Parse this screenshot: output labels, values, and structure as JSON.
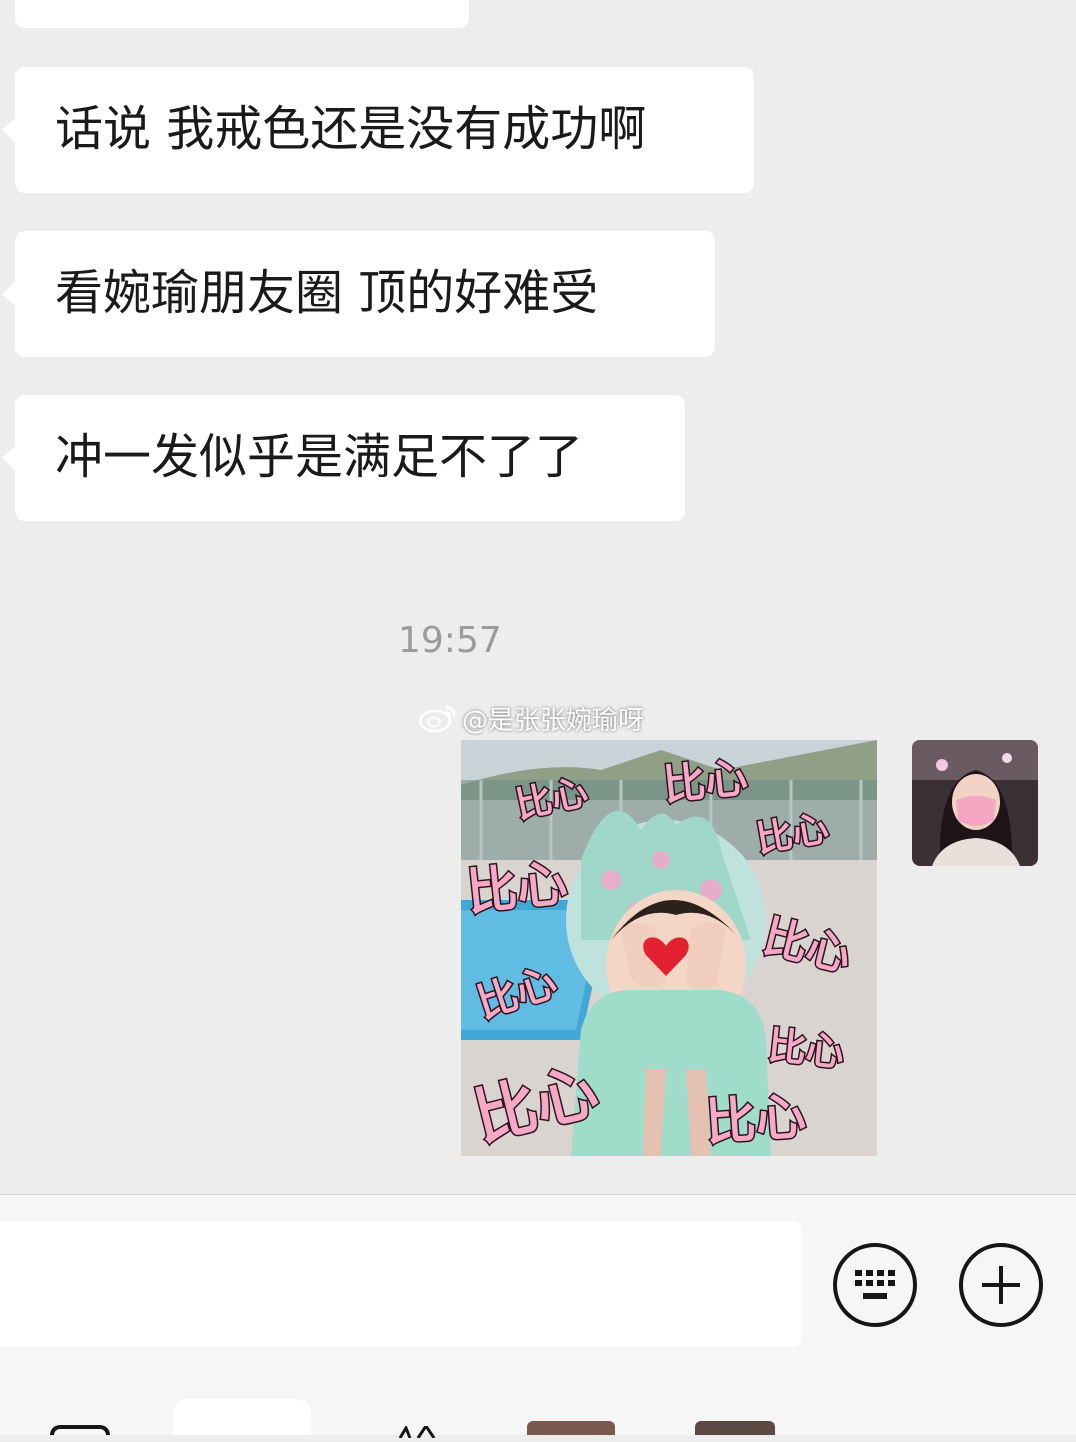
{
  "messages": [
    {
      "text": "话说 我戒色还是没有成功啊"
    },
    {
      "text": "看婉瑜朋友圈 顶的好难受"
    },
    {
      "text": "冲一发似乎是满足不了了"
    }
  ],
  "timestamp": "19:57",
  "sticker": {
    "watermark": "@是张张婉瑜呀",
    "caption": "比心",
    "colors": {
      "text_fill": "#f7a8c4",
      "text_outline": "#2a1420",
      "heart": "#e2202f"
    }
  },
  "input_bar": {
    "keyboard_icon": "keyboard-icon",
    "add_icon": "plus-icon"
  }
}
